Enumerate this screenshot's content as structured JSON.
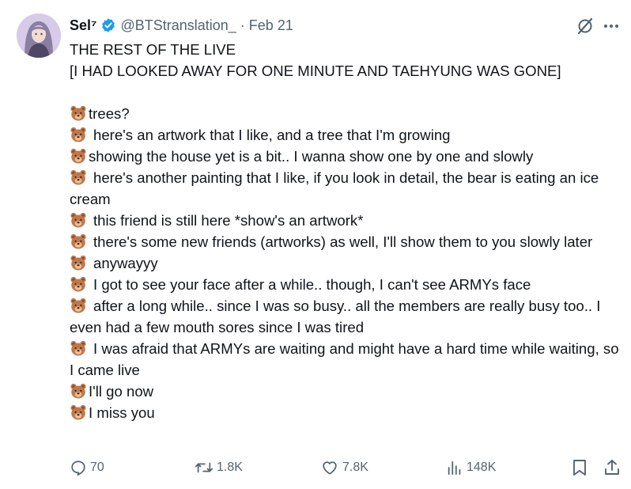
{
  "author": {
    "display_name": "Sel⁷",
    "handle": "@BTStranslation_",
    "separator": "·",
    "date": "Feb 21"
  },
  "icons": {
    "verified": "verified-badge-icon",
    "grok": "grok-icon",
    "more": "more-options-icon",
    "bear": "bear-emoji",
    "reply": "reply-icon",
    "retweet": "retweet-icon",
    "like": "like-icon",
    "views": "views-icon",
    "bookmark": "bookmark-icon",
    "share": "share-icon"
  },
  "colors": {
    "text": "#0f1419",
    "secondary": "#536471",
    "verified": "#1d9bf0",
    "bear": "#c0784a"
  },
  "tweet": {
    "heading_1": "THE REST OF THE LIVE",
    "heading_2": "[I HAD LOOKED AWAY FOR ONE MINUTE AND TAEHYUNG WAS GONE]",
    "lines": [
      "trees?",
      "here's an artwork that I like, and a tree that I'm growing",
      "showing the house yet is a bit.. I wanna show one by one and slowly",
      "here's another painting that I like, if you look in detail, the bear is eating an ice cream",
      "this friend is still here *show's an artwork*",
      "there's some new friends (artworks) as well, I'll show them to you slowly later",
      "anywayyy",
      "I got to see your face after a while.. though, I can't see ARMYs face",
      "after a long while.. since I was so busy.. all the members are really busy too.. I even had a few mouth sores since I was tired",
      "I was afraid that ARMYs are waiting and might have a hard time while waiting, so I came live",
      "I'll go now",
      "I miss you"
    ]
  },
  "stats": {
    "replies": "70",
    "retweets": "1.8K",
    "likes": "7.8K",
    "views": "148K"
  }
}
